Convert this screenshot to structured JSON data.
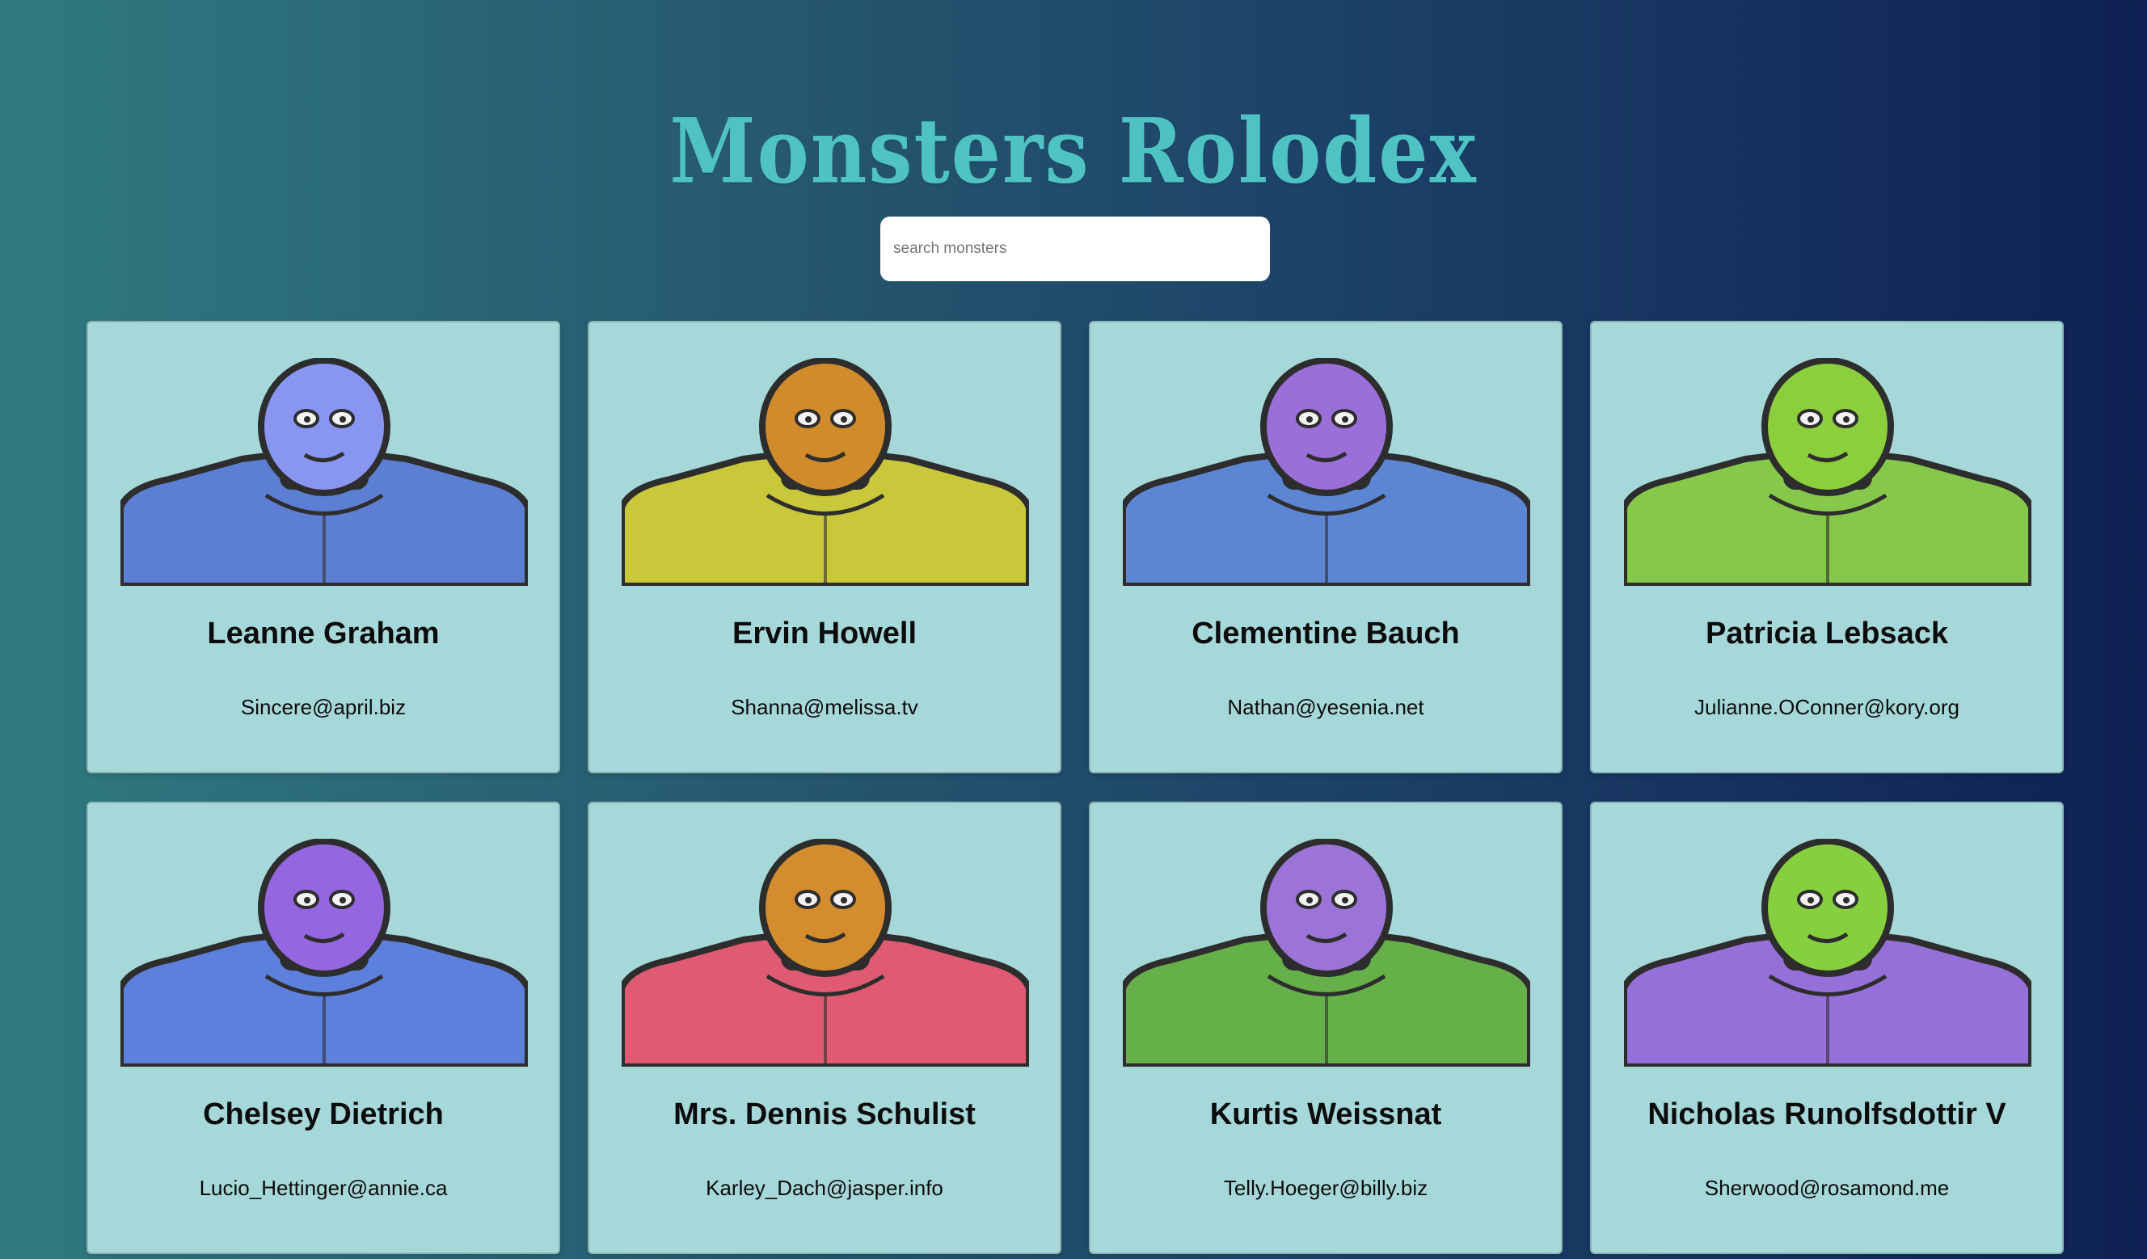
{
  "app": {
    "title": "Monsters Rolodex"
  },
  "search": {
    "placeholder": "search monsters",
    "value": ""
  },
  "monsters": [
    {
      "name": "Leanne Graham",
      "email": "Sincere@april.biz",
      "head_color": "#8896f2",
      "body_color": "#5c7fd4",
      "icon": "horned-monster-icon"
    },
    {
      "name": "Ervin Howell",
      "email": "Shanna@melissa.tv",
      "head_color": "#d08b2a",
      "body_color": "#c9c73a",
      "icon": "smiling-monster-icon"
    },
    {
      "name": "Clementine Bauch",
      "email": "Nathan@yesenia.net",
      "head_color": "#9b6fd8",
      "body_color": "#5c86d4",
      "icon": "cyclops-monster-icon"
    },
    {
      "name": "Patricia Lebsack",
      "email": "Julianne.OConner@kory.org",
      "head_color": "#8ccf3c",
      "body_color": "#86c94a",
      "icon": "helmet-monster-icon"
    },
    {
      "name": "Chelsey Dietrich",
      "email": "Lucio_Hettinger@annie.ca",
      "head_color": "#9466e0",
      "body_color": "#5c80dc",
      "icon": "robot-monster-icon"
    },
    {
      "name": "Mrs. Dennis Schulist",
      "email": "Karley_Dach@jasper.info",
      "head_color": "#d38d2e",
      "body_color": "#e05a73",
      "icon": "antenna-monster-icon"
    },
    {
      "name": "Kurtis Weissnat",
      "email": "Telly.Hoeger@billy.biz",
      "head_color": "#9c74d8",
      "body_color": "#66b04a",
      "icon": "horn-monster-icon"
    },
    {
      "name": "Nicholas Runolfsdottir V",
      "email": "Sherwood@rosamond.me",
      "head_color": "#86cf3e",
      "body_color": "#9570d8",
      "icon": "robot-monster-icon"
    }
  ]
}
